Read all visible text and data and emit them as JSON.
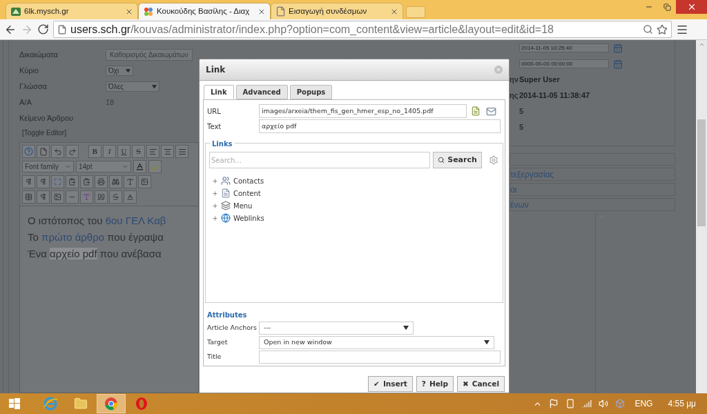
{
  "browser": {
    "tabs": [
      {
        "title": "6lk.mysch.gr",
        "kind": "site",
        "selected": false
      },
      {
        "title": "Κουκούδης Βασίλης - Διαχ",
        "kind": "joomla",
        "selected": true
      },
      {
        "title": "Εισαγωγή συνδέσμων",
        "kind": "page",
        "selected": false
      }
    ],
    "url_host": "users.sch.gr",
    "url_path": "/kouvas/administrator/index.php?option=com_content&view=article&layout=edit&id=18"
  },
  "form": [
    {
      "label": "Δικαιώματα",
      "value": "Καθορισμός Δικαιωμάτων",
      "kind": "button"
    },
    {
      "label": "Κύριο",
      "value": "Όχι",
      "kind": "select"
    },
    {
      "label": "Γλώσσα",
      "value": "Όλες",
      "kind": "select"
    },
    {
      "label": "Α/Α",
      "value": "18",
      "kind": "text"
    },
    {
      "label": "Κείμενο Άρθρου",
      "kind": "heading"
    }
  ],
  "editor": {
    "toggle": "[Toggle Editor]",
    "format_buttons": [
      "B",
      "I",
      "U",
      "S"
    ],
    "font_family": "Font family",
    "font_size": "14pt",
    "paragraphs": [
      [
        {
          "text": "Ο ιστότοπος του ",
          "kind": "plain"
        },
        {
          "text": "6ου ΓΕΛ Καβ",
          "kind": "link"
        }
      ],
      [
        {
          "text": "Το ",
          "kind": "plain"
        },
        {
          "text": "πρώτο άρθρο",
          "kind": "link"
        },
        {
          "text": " που έγραψα",
          "kind": "plain"
        }
      ],
      [
        {
          "text": "Ένα ",
          "kind": "plain"
        },
        {
          "text": "αρχείο pdf",
          "kind": "highlight"
        },
        {
          "text": " που ανέβασα",
          "kind": "plain"
        }
      ]
    ]
  },
  "details": [
    {
      "kind": "date",
      "value": "2014-11-05 10:25:40"
    },
    {
      "kind": "date",
      "value": "0000-00-00 00:00:00"
    },
    {
      "kind": "info",
      "label": "ην",
      "value": "Super User"
    },
    {
      "kind": "info",
      "label": "ης",
      "value": "2014-11-05 11:38:47"
    },
    {
      "kind": "plain",
      "value": "5"
    },
    {
      "kind": "plain",
      "value": "5"
    }
  ],
  "panels": [
    "τεξεργασίας",
    "οι",
    "ένων"
  ],
  "dialog": {
    "title": "Link",
    "tabs": [
      {
        "label": "Link",
        "selected": true
      },
      {
        "label": "Advanced",
        "selected": false
      },
      {
        "label": "Popups",
        "selected": false
      }
    ],
    "url_label": "URL",
    "url": "images/arxeia/them_fis_gen_hmer_esp_no_1405.pdf",
    "text_label": "Text",
    "text": "αρχείο pdf",
    "links": {
      "legend": "Links",
      "search_placeholder": "Search...",
      "search_button": "Search",
      "tree": [
        {
          "label": "Contacts",
          "kind": "contacts",
          "expanded": false
        },
        {
          "label": "Content",
          "kind": "content",
          "expanded": false
        },
        {
          "label": "Menu",
          "kind": "menu",
          "expanded": false
        },
        {
          "label": "Weblinks",
          "kind": "weblinks",
          "expanded": false
        }
      ]
    },
    "attributes": {
      "legend": "Attributes",
      "fields": [
        {
          "label": "Article Anchors",
          "value": "---",
          "kind": "short_select"
        },
        {
          "label": "Target",
          "value": "Open in new window",
          "kind": "select"
        },
        {
          "label": "Title",
          "kind": "input"
        }
      ]
    },
    "buttons": [
      {
        "icon": "✔",
        "label": "Insert"
      },
      {
        "icon": "?",
        "label": "Help"
      },
      {
        "icon": "✖",
        "label": "Cancel"
      }
    ]
  },
  "taskbar": {
    "apps": [
      {
        "kind": "ie",
        "selected": false
      },
      {
        "kind": "explorer",
        "selected": false
      },
      {
        "kind": "chrome",
        "selected": true
      },
      {
        "kind": "opera",
        "selected": false
      }
    ],
    "language": "ENG",
    "clock": "4:55 μμ"
  }
}
